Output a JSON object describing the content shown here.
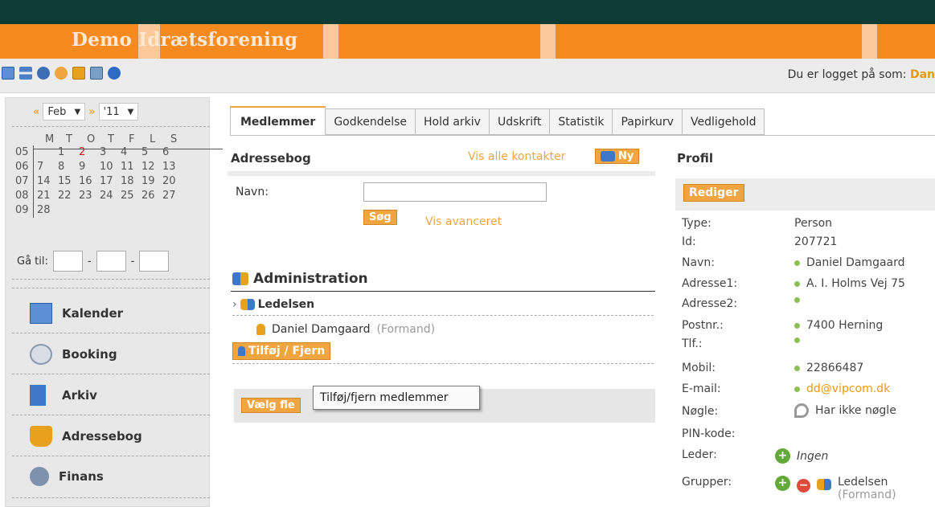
{
  "header": {
    "title": "Demo Idrætsforening"
  },
  "toolbar": {
    "icons": [
      "calendar-grid-icon",
      "transfer-arrows-icon",
      "settings-gear-icon",
      "sync-icon",
      "calendar-date-icon",
      "monitor-icon",
      "help-icon"
    ],
    "logged_in_label": "Du er logget på som:",
    "logged_in_user": "Dan"
  },
  "calendar": {
    "prev": "«",
    "month": "Feb",
    "next": "»",
    "year": "'11",
    "weekday_headers": [
      "M",
      "T",
      "O",
      "T",
      "F",
      "L",
      "S"
    ],
    "weeks": [
      {
        "week": "05",
        "days": [
          "",
          "1",
          "2",
          "3",
          "4",
          "5",
          "6"
        ]
      },
      {
        "week": "06",
        "days": [
          "7",
          "8",
          "9",
          "10",
          "11",
          "12",
          "13"
        ]
      },
      {
        "week": "07",
        "days": [
          "14",
          "15",
          "16",
          "17",
          "18",
          "19",
          "20"
        ]
      },
      {
        "week": "08",
        "days": [
          "21",
          "22",
          "23",
          "24",
          "25",
          "26",
          "27"
        ]
      },
      {
        "week": "09",
        "days": [
          "28",
          "",
          "",
          "",
          "",
          "",
          ""
        ]
      }
    ],
    "today": "2",
    "goto_label": "Gå til:",
    "sep": "-"
  },
  "nav": [
    {
      "label": "Kalender",
      "icon": "calendar-icon"
    },
    {
      "label": "Booking",
      "icon": "booking-icon"
    },
    {
      "label": "Arkiv",
      "icon": "archive-icon"
    },
    {
      "label": "Adressebog",
      "icon": "address-book-icon"
    },
    {
      "label": "Finans",
      "icon": "finance-icon"
    }
  ],
  "tabs": [
    "Medlemmer",
    "Godkendelse",
    "Hold arkiv",
    "Udskrift",
    "Statistik",
    "Papirkurv",
    "Vedligehold"
  ],
  "addressbook": {
    "title": "Adressebog",
    "show_all": "Vis alle kontakter",
    "new_button": "Ny",
    "name_label": "Navn:",
    "name_value": "",
    "search_button": "Søg",
    "advanced_link": "Vis avanceret",
    "group_title": "Administration",
    "subgroup": "Ledelsen",
    "member_name": "Daniel Damgaard",
    "member_role": "(Formand)",
    "add_remove_button": "Tilføj / Fjern",
    "choose_button": "Vælg fle",
    "tooltip": "Tilføj/fjern medlemmer"
  },
  "profile": {
    "title": "Profil",
    "edit_button": "Rediger",
    "fields": [
      {
        "label": "Type:",
        "value": "Person"
      },
      {
        "label": "Id:",
        "value": "207721"
      },
      {
        "label": "Navn:",
        "value": "Daniel Damgaard"
      },
      {
        "label": "Adresse1:",
        "value": "A. I. Holms Vej 75"
      },
      {
        "label": "Adresse2:",
        "value": ""
      },
      {
        "label": "Postnr.:",
        "value": "7400 Herning"
      },
      {
        "label": "Tlf.:",
        "value": ""
      },
      {
        "label": "Mobil:",
        "value": "22866487"
      },
      {
        "label": "E-mail:",
        "value": "dd@vipcom.dk"
      },
      {
        "label": "Nøgle:",
        "value": "Har ikke nøgle"
      },
      {
        "label": "PIN-kode:",
        "value": ""
      },
      {
        "label": "Leder:",
        "value": "Ingen"
      },
      {
        "label": "Grupper:",
        "value": "Ledelsen"
      }
    ],
    "group_role": "(Formand)"
  },
  "colors": {
    "accent": "#f0a540",
    "banner": "#f68a1e",
    "topbar": "#0f3b35"
  }
}
